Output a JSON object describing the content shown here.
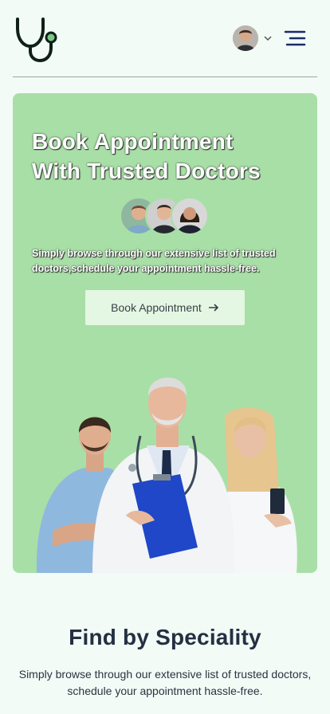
{
  "header": {
    "logo_icon": "stethoscope-icon",
    "profile_icon": "user-avatar",
    "chevron_icon": "chevron-down-icon",
    "menu_icon": "hamburger-menu-icon"
  },
  "hero": {
    "title_line1": "Book Appointment",
    "title_line2": "With Trusted Doctors",
    "subtitle": "Simply browse through our extensive list of trusted doctors,schedule your appointment hassle-free.",
    "button_label": "Book Appointment",
    "button_icon": "arrow-right-icon",
    "background_color": "#a8dfa6"
  },
  "speciality": {
    "title": "Find by Speciality",
    "subtitle": "Simply browse through our extensive list of trusted doctors, schedule your appointment hassle-free."
  }
}
